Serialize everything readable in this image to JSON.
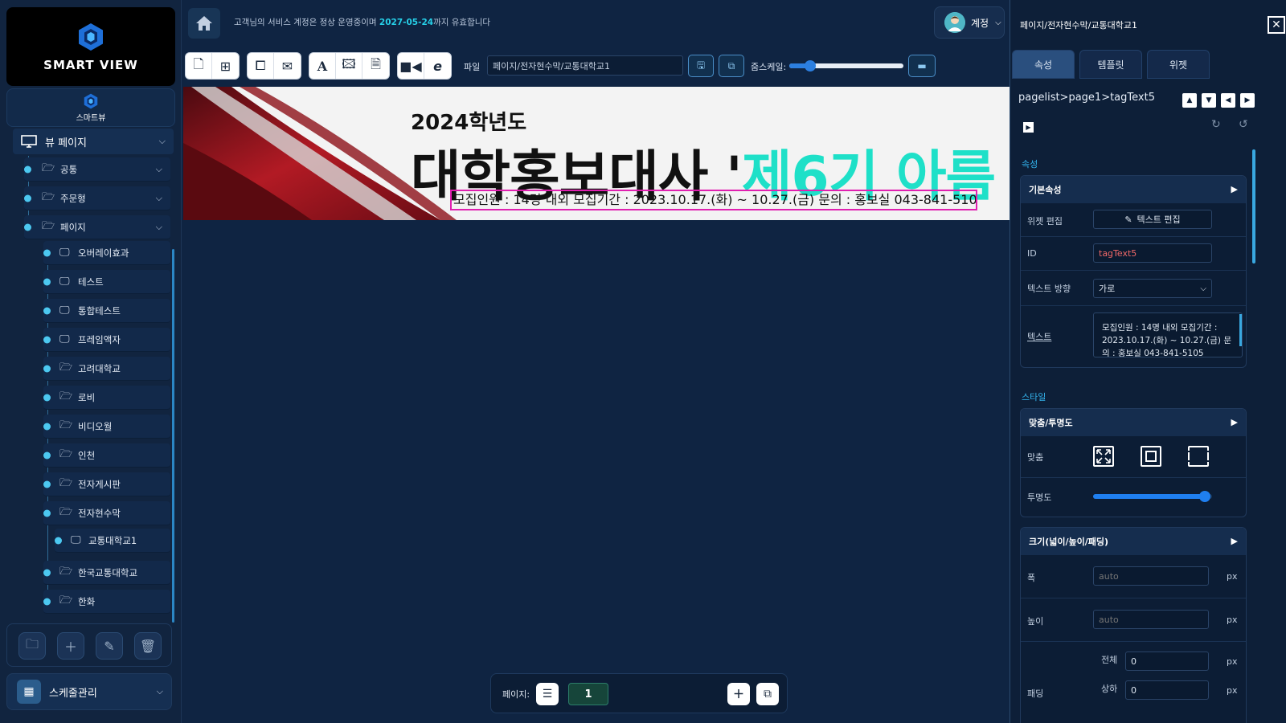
{
  "sidebar": {
    "logo_text": "SMART VIEW",
    "sublogo_text": "스마트뷰",
    "root_label": "뷰 페이지",
    "groups": [
      {
        "label": "공통"
      },
      {
        "label": "주문형"
      },
      {
        "label": "페이지"
      }
    ],
    "pages": [
      {
        "label": "오버레이효과",
        "icon": "monitor-icon"
      },
      {
        "label": "테스트",
        "icon": "monitor-icon"
      },
      {
        "label": "통합테스트",
        "icon": "monitor-icon"
      },
      {
        "label": "프레임액자",
        "icon": "monitor-icon"
      },
      {
        "label": "고려대학교",
        "icon": "folder-icon"
      },
      {
        "label": "로비",
        "icon": "folder-icon"
      },
      {
        "label": "비디오월",
        "icon": "folder-icon"
      },
      {
        "label": "인천",
        "icon": "folder-icon"
      },
      {
        "label": "전자게시판",
        "icon": "folder-icon"
      },
      {
        "label": "전자현수막",
        "icon": "folder-icon"
      }
    ],
    "subpage": {
      "label": "교통대학교1",
      "icon": "monitor-icon"
    },
    "pages_after": [
      {
        "label": "한국교통대학교",
        "icon": "folder-icon"
      },
      {
        "label": "한화",
        "icon": "folder-icon"
      }
    ],
    "schedule_label": "스케줄관리"
  },
  "topbar": {
    "notice_prefix": "고객님의 서비스 계정은 정상 운영중이며 ",
    "notice_date": "2027-05-24",
    "notice_suffix": "까지 유효합니다",
    "account_label": "계정"
  },
  "toolbar": {
    "file_label": "파일",
    "file_value": "페이지/전자현수막/교통대학교1",
    "zoom_label": "줌스케일:",
    "zoom_value": 0.18
  },
  "banner": {
    "year_line": "2024학년도",
    "title_black": "대학홍보대사 '",
    "title_cyan": "제6기 아름",
    "info_line": "모집인원 : 14명 내외 모집기간 : 2023.10.17.(화) ~ 10.27.(금) 문의 : 홍보실 043-841-5105"
  },
  "pager": {
    "label": "페이지:",
    "current": "1"
  },
  "panel": {
    "title": "페이지/전자현수막/교통대학교1",
    "tabs": [
      "속성",
      "템플릿",
      "위젯"
    ],
    "path": "pagelist>page1>tagText5",
    "section_props": "속성",
    "basic_header": "기본속성",
    "widget_edit_label": "위젯 편집",
    "text_edit_button": "텍스트 편집",
    "id_label": "ID",
    "id_value": "tagText5",
    "direction_label": "텍스트 방향",
    "direction_value": "가로",
    "text_label": "텍스트",
    "text_value": "모집인원 : 14명 내외 모집기간 : 2023.10.17.(화) ~ 10.27.(금) 문의 : 홍보실 043-841-5105",
    "section_style": "스타일",
    "fit_header": "맞춤/투명도",
    "fit_label": "맞춤",
    "opacity_label": "투명도",
    "opacity_value": 0.94,
    "size_header": "크기(넓이/높이/패딩)",
    "width_label": "폭",
    "width_placeholder": "auto",
    "height_label": "높이",
    "height_placeholder": "auto",
    "unit": "px",
    "padding_label": "패딩",
    "padding_all_label": "전체",
    "padding_all_value": "0",
    "padding_top_label": "상하",
    "padding_top_value": "0"
  },
  "colors": {
    "accent": "#26d0e8",
    "panel_bg": "#0d1f38",
    "app_bg": "#0f2442",
    "id_text": "#f06868",
    "highlight_box": "#e020b0"
  }
}
